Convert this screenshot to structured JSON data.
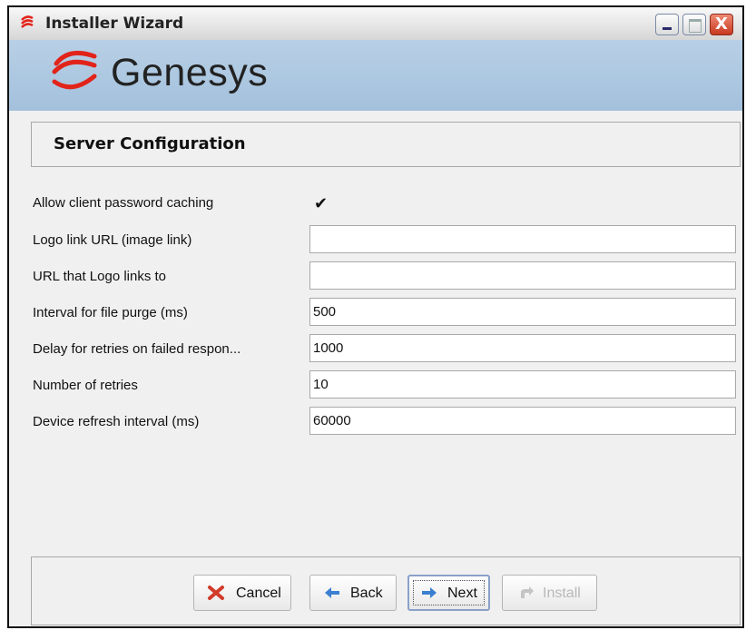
{
  "window": {
    "title": "Installer Wizard",
    "close_glyph": "X"
  },
  "banner": {
    "logo_text": "Genesys",
    "logo_color": "#e2231a"
  },
  "header": {
    "title": "Server Configuration"
  },
  "form": {
    "rows": [
      {
        "label": "Allow client password caching",
        "type": "checkbox",
        "checked": true,
        "check_glyph": "✔"
      },
      {
        "label": "Logo link URL (image link)",
        "value": ""
      },
      {
        "label": "URL that Logo links to",
        "value": ""
      },
      {
        "label": "Interval for file purge (ms)",
        "value": "500"
      },
      {
        "label": "Delay for retries on failed respon...",
        "value": "1000"
      },
      {
        "label": "Number of retries",
        "value": "10"
      },
      {
        "label": "Device refresh interval (ms)",
        "value": "60000"
      }
    ]
  },
  "buttons": {
    "cancel": {
      "label": "Cancel",
      "icon": "cancel-x-icon",
      "color": "#d23a2a"
    },
    "back": {
      "label": "Back",
      "icon": "arrow-left-icon",
      "color": "#3a7fd0"
    },
    "next": {
      "label": "Next",
      "icon": "arrow-right-icon",
      "color": "#3a7fd0"
    },
    "install": {
      "label": "Install",
      "icon": "install-arrow-icon",
      "enabled": false
    }
  }
}
